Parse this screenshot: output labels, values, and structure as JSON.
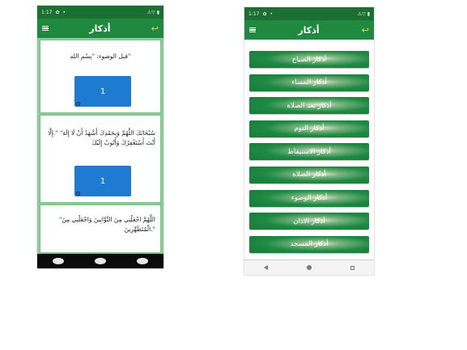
{
  "left_screen": {
    "status": {
      "time": "1:17",
      "icons": [
        "settings-icon",
        "dot-icon"
      ],
      "right": "⚠▽ ▮"
    },
    "appbar": {
      "title": "أذكار",
      "menu_icon": "hamburger-icon",
      "back_icon": "back-arrow-icon"
    },
    "cards": [
      {
        "text": "\"قبل الوضوء: \"بِسْمِ اللهِ",
        "counter": "1"
      },
      {
        "text": "سُبْحَانَكَ اللَّهُمَّ وَبِحَمْدِكَ أَشْهَدُ أَنْ لَا إِلَهَ\" \".إِلَّا أَنْتَ أَسْتَغْفِرُكَ وَأَتُوبُ إِلَيْكَ",
        "counter": "1"
      },
      {
        "text": "اللَّهُمَّ اجْعَلْنِي مِنَ التَّوَّابِينَ وَاجْعَلْنِي مِنَ\" \".الْمُتَطَهِّرِينَ"
      }
    ]
  },
  "right_screen": {
    "status": {
      "time": "1:17",
      "icons": [
        "settings-icon",
        "dot-icon"
      ],
      "right": "⚠▽ ▮"
    },
    "appbar": {
      "title": "أذكار",
      "menu_icon": "hamburger-icon",
      "back_icon": "back-arrow-icon"
    },
    "menu_items": [
      "أذكار الصباح",
      "أذكار المساء",
      "أذكار بعد الصلاة",
      "أذكار النوم",
      "أذكار الاستيقاظ",
      "أذكار الصلاة",
      "أذكار الوضوء",
      "أذكار الاذان",
      "أذكار المسجد"
    ]
  },
  "colors": {
    "appbar": "#1f8a3f",
    "statusbar": "#1b6f33",
    "counter": "#1f7bd0",
    "back_arrow": "#f2d54a"
  }
}
